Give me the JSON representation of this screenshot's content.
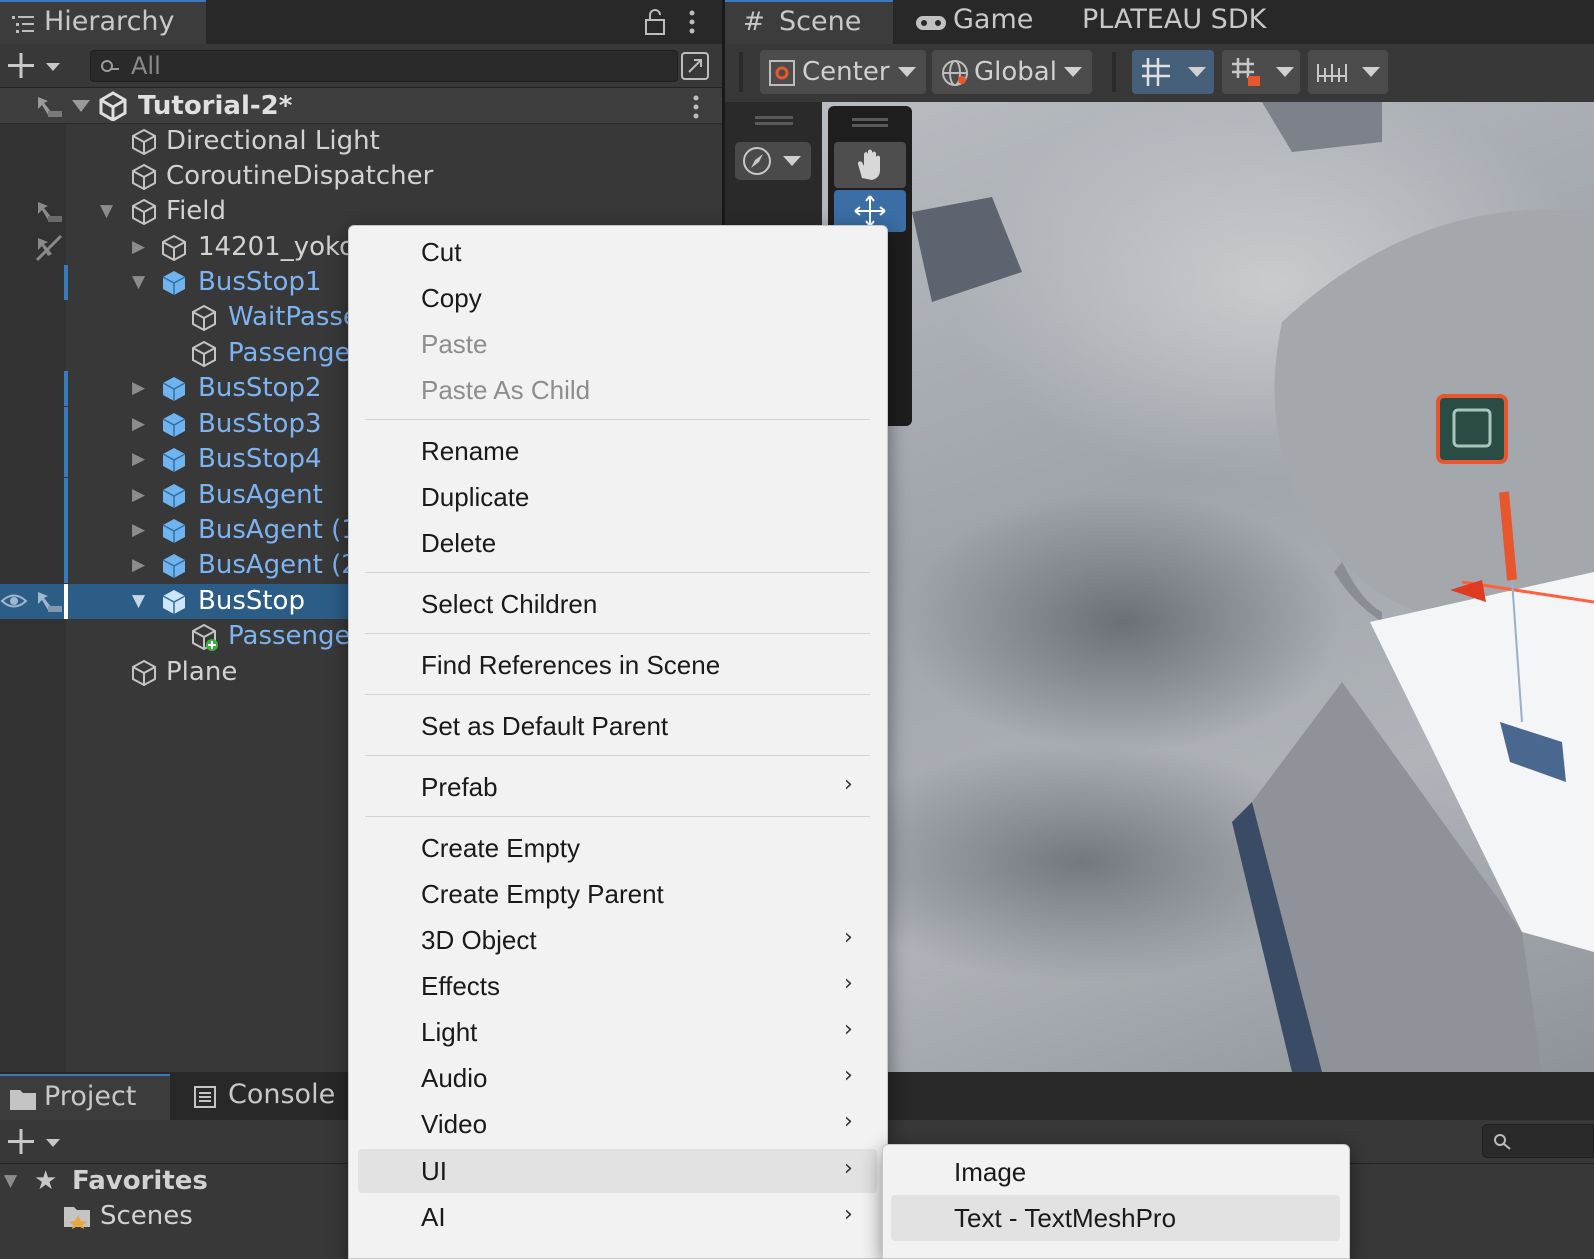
{
  "hierarchy": {
    "tab_label": "Hierarchy",
    "search_placeholder": "All",
    "scene_name": "Tutorial-2*",
    "items": [
      {
        "label": "Directional Light"
      },
      {
        "label": "CoroutineDispatcher"
      },
      {
        "label": "Field"
      },
      {
        "label": "14201_yoko"
      },
      {
        "label": "BusStop1"
      },
      {
        "label": "WaitPasse"
      },
      {
        "label": "Passenge"
      },
      {
        "label": "BusStop2"
      },
      {
        "label": "BusStop3"
      },
      {
        "label": "BusStop4"
      },
      {
        "label": "BusAgent"
      },
      {
        "label": "BusAgent (1"
      },
      {
        "label": "BusAgent (2"
      },
      {
        "label": "BusStop"
      },
      {
        "label": "Passenge"
      },
      {
        "label": "Plane"
      }
    ]
  },
  "scene_view": {
    "tabs": [
      {
        "label": "Scene"
      },
      {
        "label": "Game"
      },
      {
        "label": "PLATEAU SDK"
      }
    ],
    "toolbar": {
      "pivot_label": "Center",
      "space_label": "Global"
    }
  },
  "bottom_panel": {
    "tabs": [
      {
        "label": "Project"
      },
      {
        "label": "Console"
      }
    ],
    "favorites_label": "Favorites",
    "scenes_label": "Scenes"
  },
  "context_menu": {
    "items": [
      {
        "label": "Cut"
      },
      {
        "label": "Copy"
      },
      {
        "label": "Paste"
      },
      {
        "label": "Paste As Child"
      },
      {
        "label": "Rename"
      },
      {
        "label": "Duplicate"
      },
      {
        "label": "Delete"
      },
      {
        "label": "Select Children"
      },
      {
        "label": "Find References in Scene"
      },
      {
        "label": "Set as Default Parent"
      },
      {
        "label": "Prefab"
      },
      {
        "label": "Create Empty"
      },
      {
        "label": "Create Empty Parent"
      },
      {
        "label": "3D Object"
      },
      {
        "label": "Effects"
      },
      {
        "label": "Light"
      },
      {
        "label": "Audio"
      },
      {
        "label": "Video"
      },
      {
        "label": "UI"
      },
      {
        "label": "AI"
      }
    ],
    "submenu_arrow": "›"
  },
  "ui_submenu": {
    "items": [
      {
        "label": "Image"
      },
      {
        "label": "Text - TextMeshPro"
      }
    ]
  },
  "colors": {
    "selection": "#2c5d87",
    "prefab_text": "#7cb3f0",
    "accent": "#3a79bb"
  }
}
